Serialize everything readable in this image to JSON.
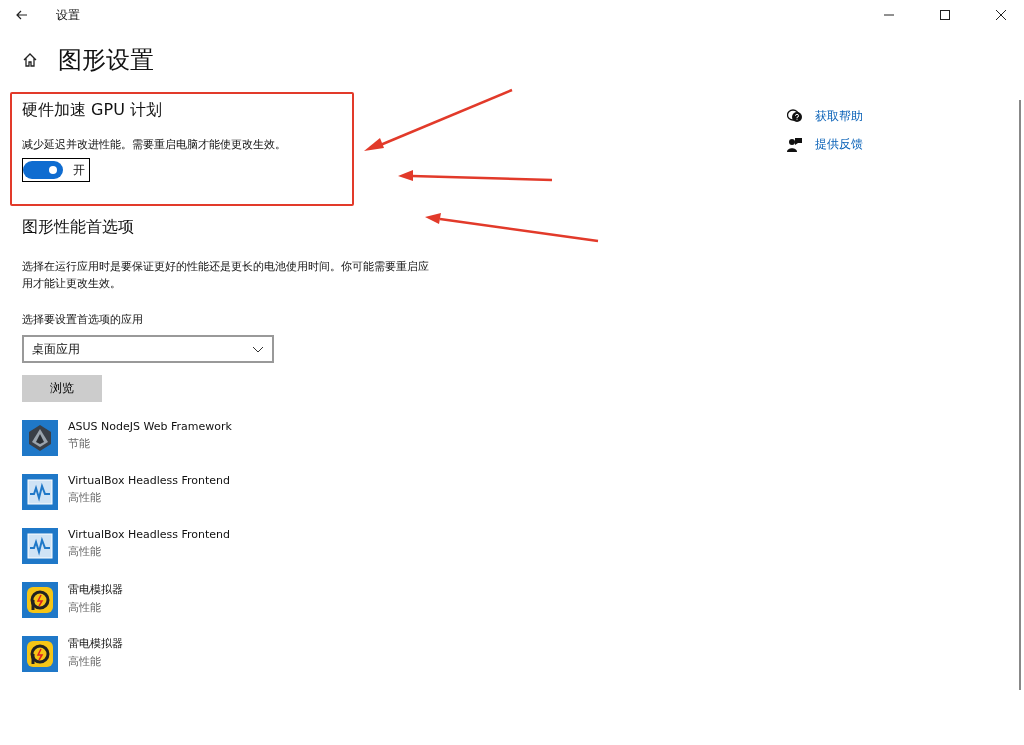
{
  "window": {
    "title": "设置"
  },
  "page_title": "图形设置",
  "gpu_scheduling": {
    "title": "硬件加速 GPU 计划",
    "description": "减少延迟并改进性能。需要重启电脑才能使更改生效。",
    "toggle": {
      "on": true,
      "label": "开"
    }
  },
  "preference": {
    "title": "图形性能首选项",
    "description": "选择在运行应用时是要保证更好的性能还是更长的电池使用时间。你可能需要重启应用才能让更改生效。",
    "select_label": "选择要设置首选项的应用",
    "select_value": "桌面应用",
    "browse_button": "浏览"
  },
  "apps": [
    {
      "kind": "asus",
      "name": "ASUS NodeJS Web Framework",
      "preference": "节能"
    },
    {
      "kind": "vbox",
      "name": "VirtualBox Headless Frontend",
      "preference": "高性能"
    },
    {
      "kind": "vbox",
      "name": "VirtualBox Headless Frontend",
      "preference": "高性能"
    },
    {
      "kind": "ldplayer",
      "name": "雷电模拟器",
      "preference": "高性能"
    },
    {
      "kind": "ldplayer",
      "name": "雷电模拟器",
      "preference": "高性能"
    }
  ],
  "links": [
    {
      "kind": "help",
      "label": "获取帮助"
    },
    {
      "kind": "feedback",
      "label": "提供反馈"
    }
  ]
}
